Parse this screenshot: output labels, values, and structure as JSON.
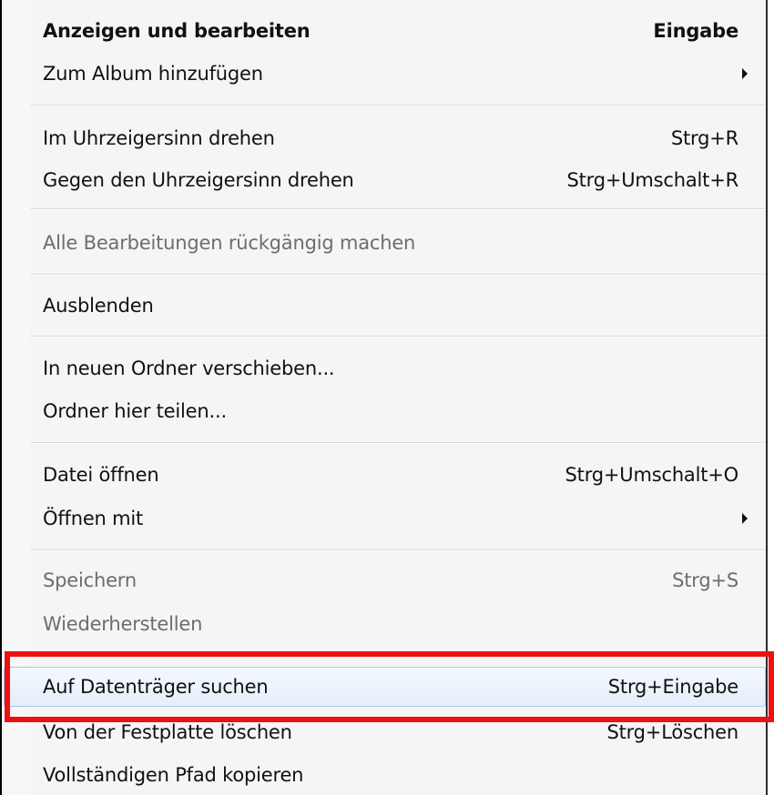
{
  "menu": {
    "items": [
      {
        "label": "Anzeigen und bearbeiten",
        "shortcut": "Eingabe"
      },
      {
        "label": "Zum Album hinzufügen",
        "submenu_icon": "chevron-right-icon"
      },
      {
        "label": "Im Uhrzeigersinn drehen",
        "shortcut": "Strg+R"
      },
      {
        "label": "Gegen den Uhrzeigersinn drehen",
        "shortcut": "Strg+Umschalt+R"
      },
      {
        "label": "Alle Bearbeitungen rückgängig machen",
        "disabled": true
      },
      {
        "label": "Ausblenden"
      },
      {
        "label": "In neuen Ordner verschieben..."
      },
      {
        "label": "Ordner hier teilen..."
      },
      {
        "label": "Datei öffnen",
        "shortcut": "Strg+Umschalt+O"
      },
      {
        "label": "Öffnen mit",
        "submenu_icon": "chevron-right-icon"
      },
      {
        "label": "Speichern",
        "shortcut": "Strg+S",
        "disabled": true
      },
      {
        "label": "Wiederherstellen",
        "disabled": true
      },
      {
        "label": "Auf Datenträger suchen",
        "shortcut": "Strg+Eingabe",
        "highlighted": true
      },
      {
        "label": "Von der Festplatte löschen",
        "shortcut": "Strg+Löschen"
      },
      {
        "label": "Vollständigen Pfad kopieren"
      }
    ]
  },
  "colors": {
    "annotation_frame": "#ee1111",
    "hover_fill": "#e5effa",
    "hover_border": "#a8c8ec",
    "disabled_text": "#6d6d6d"
  }
}
